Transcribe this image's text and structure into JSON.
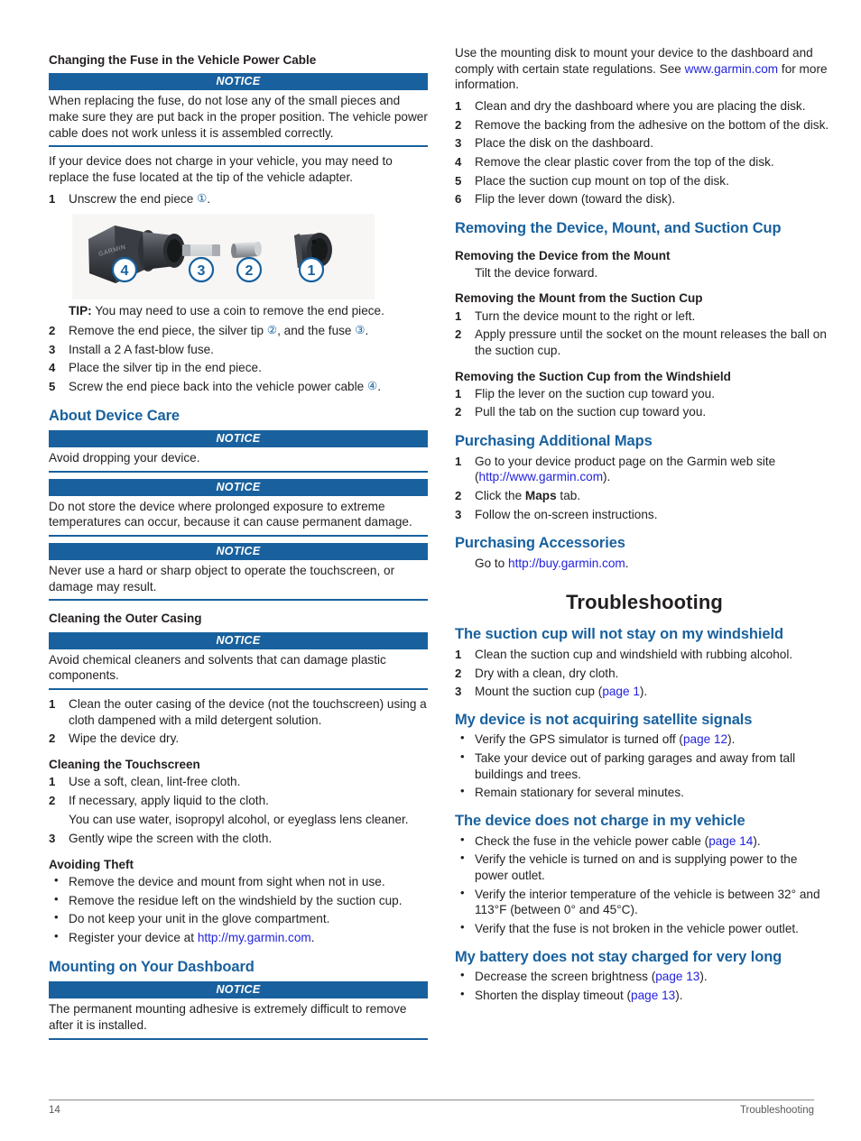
{
  "footer": {
    "page_number": "14",
    "chapter": "Troubleshooting"
  },
  "notice_label": "NOTICE",
  "left_column": {
    "fuse_section": {
      "heading": "Changing the Fuse in the Vehicle Power Cable",
      "notice": "When replacing the fuse, do not lose any of the small pieces and make sure they are put back in the proper position. The vehicle power cable does not work unless it is assembled correctly.",
      "intro": "If your device does not charge in your vehicle, you may need to replace the fuse located at the tip of the vehicle adapter.",
      "step1_pre": "Unscrew the end piece ",
      "step1_ref": "①",
      "step1_post": ".",
      "figure_callouts": [
        "④",
        "③",
        "②",
        "①"
      ],
      "figure_brand": "GARMIN",
      "tip_label": "TIP:",
      "tip_text": " You may need to use a coin to remove the end piece.",
      "step2_a": "Remove the end piece, the silver tip ",
      "step2_ref1": "②",
      "step2_b": ", and the fuse ",
      "step2_ref2": "③",
      "step2_c": ".",
      "step3": "Install a 2 A fast-blow fuse.",
      "step4": "Place the silver tip in the end piece.",
      "step5_a": "Screw the end piece back into the vehicle power cable ",
      "step5_ref": "④",
      "step5_b": ".",
      "nums": [
        "1",
        "2",
        "3",
        "4",
        "5"
      ]
    },
    "device_care": {
      "heading": "About Device Care",
      "notice1": "Avoid dropping your device.",
      "notice2": "Do not store the device where prolonged exposure to extreme temperatures can occur, because it can cause permanent damage.",
      "notice3": "Never use a hard or sharp object to operate the touchscreen, or damage may result."
    },
    "outer_casing": {
      "heading": "Cleaning the Outer Casing",
      "notice": "Avoid chemical cleaners and solvents that can damage plastic components.",
      "steps": [
        {
          "num": "1",
          "text": "Clean the outer casing of the device (not the touchscreen) using a cloth dampened with a mild detergent solution."
        },
        {
          "num": "2",
          "text": "Wipe the device dry."
        }
      ]
    },
    "touchscreen": {
      "heading": "Cleaning the Touchscreen",
      "steps": [
        {
          "num": "1",
          "text": "Use a soft, clean, lint-free cloth."
        },
        {
          "num": "2",
          "text": "If necessary, apply liquid to the cloth.",
          "note": "You can use water, isopropyl alcohol, or eyeglass lens cleaner."
        },
        {
          "num": "3",
          "text": "Gently wipe the screen with the cloth."
        }
      ]
    },
    "avoiding_theft": {
      "heading": "Avoiding Theft",
      "bullets": [
        {
          "text": "Remove the device and mount from sight when not in use."
        },
        {
          "text": "Remove the residue left on the windshield by the suction cup."
        },
        {
          "text": "Do not keep your unit in the glove compartment."
        },
        {
          "pre": "Register your device at ",
          "link": "http://my.garmin.com",
          "post": "."
        }
      ]
    },
    "dashboard": {
      "heading": "Mounting on Your Dashboard",
      "notice": "The permanent mounting adhesive is extremely difficult to remove after it is installed."
    }
  },
  "right_column": {
    "dashboard_cont": {
      "intro_a": "Use the mounting disk to mount your device to the dashboard and comply with certain state regulations. See ",
      "intro_link": "www.garmin.com",
      "intro_b": " for more information.",
      "steps": [
        {
          "num": "1",
          "text": "Clean and dry the dashboard where you are placing the disk."
        },
        {
          "num": "2",
          "text": "Remove the backing from the adhesive on the bottom of the disk."
        },
        {
          "num": "3",
          "text": "Place the disk on the dashboard."
        },
        {
          "num": "4",
          "text": "Remove the clear plastic cover from the top of the disk."
        },
        {
          "num": "5",
          "text": "Place the suction cup mount on top of the disk."
        },
        {
          "num": "6",
          "text": "Flip the lever down (toward the disk)."
        }
      ]
    },
    "removing": {
      "heading": "Removing the Device, Mount, and Suction Cup",
      "sub1": {
        "heading": "Removing the Device from the Mount",
        "text": "Tilt the device forward."
      },
      "sub2": {
        "heading": "Removing the Mount from the Suction Cup",
        "steps": [
          {
            "num": "1",
            "text": "Turn the device mount to the right or left."
          },
          {
            "num": "2",
            "text": "Apply pressure until the socket on the mount releases the ball on the suction cup."
          }
        ]
      },
      "sub3": {
        "heading": "Removing the Suction Cup from the Windshield",
        "steps": [
          {
            "num": "1",
            "text": "Flip the lever on the suction cup toward you."
          },
          {
            "num": "2",
            "text": "Pull the tab on the suction cup toward you."
          }
        ]
      }
    },
    "purchasing_maps": {
      "heading": "Purchasing Additional Maps",
      "step1_pre": "Go to your device product page on the Garmin web site (",
      "step1_link": "http://www.garmin.com",
      "step1_post": ").",
      "step2_pre": "Click the ",
      "step2_bold": "Maps",
      "step2_post": " tab.",
      "step3": "Follow the on-screen instructions.",
      "nums": [
        "1",
        "2",
        "3"
      ]
    },
    "purchasing_accessories": {
      "heading": "Purchasing Accessories",
      "text_pre": "Go to ",
      "link": "http://buy.garmin.com",
      "text_post": "."
    },
    "troubleshooting": {
      "title": "Troubleshooting",
      "suction": {
        "heading": "The suction cup will not stay on my windshield",
        "steps": [
          {
            "num": "1",
            "text": "Clean the suction cup and windshield with rubbing alcohol."
          },
          {
            "num": "2",
            "text": "Dry with a clean, dry cloth."
          },
          {
            "num": "3",
            "pre": "Mount the suction cup (",
            "ref": "page 1",
            "post": ")."
          }
        ]
      },
      "satellite": {
        "heading": "My device is not acquiring satellite signals",
        "bullets": [
          {
            "pre": "Verify the GPS simulator is turned off (",
            "ref": "page 12",
            "post": ")."
          },
          {
            "text": "Take your device out of parking garages and away from tall buildings and trees."
          },
          {
            "text": "Remain stationary for several minutes."
          }
        ]
      },
      "charge": {
        "heading": "The device does not charge in my vehicle",
        "bullets": [
          {
            "pre": "Check the fuse in the vehicle power cable (",
            "ref": "page 14",
            "post": ")."
          },
          {
            "text": "Verify the vehicle is turned on and is supplying power to the power outlet."
          },
          {
            "text": "Verify the interior temperature of the vehicle is between 32° and 113°F (between 0° and 45°C)."
          },
          {
            "text": "Verify that the fuse is not broken in the vehicle power outlet."
          }
        ]
      },
      "battery": {
        "heading": "My battery does not stay charged for very long",
        "bullets": [
          {
            "pre": "Decrease the screen brightness (",
            "ref": "page 13",
            "post": ")."
          },
          {
            "pre": "Shorten the display timeout (",
            "ref": "page 13",
            "post": ")."
          }
        ]
      }
    }
  }
}
